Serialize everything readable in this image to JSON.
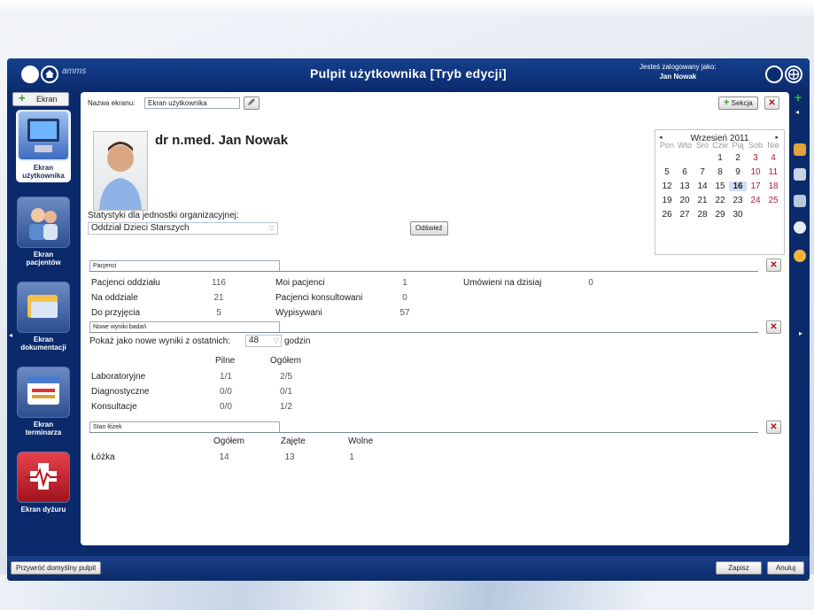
{
  "app": {
    "title": "Pulpit użytkownika [Tryb edycji]",
    "brand": "amms"
  },
  "user": {
    "logged_label": "Jesteś zalogowany jako:",
    "name": "Jan Nowak"
  },
  "leftbar": {
    "add_screen_label": "Ekran",
    "items": [
      {
        "label": "Ekran\nużytkownika",
        "icon": "desktop-icon"
      },
      {
        "label": "Ekran\npacjentów",
        "icon": "patients-icon"
      },
      {
        "label": "Ekran\ndokumentacji",
        "icon": "documents-icon"
      },
      {
        "label": "Ekran\nterminarza",
        "icon": "calendar-icon"
      },
      {
        "label": "Ekran dyżuru",
        "icon": "heartbeat-icon"
      }
    ]
  },
  "screen": {
    "name_label": "Nazwa ekranu:",
    "name_value": "Ekran użytkownika",
    "add_section_label": "Sekcja"
  },
  "doctor": {
    "name": "dr n.med. Jan Nowak"
  },
  "org": {
    "label": "Statystyki dla jednostki organizacyjnej:",
    "selected": "Oddział Dzieci Starszych",
    "refresh_label": "Odśwież"
  },
  "calendar": {
    "month": "Wrzesień 2011",
    "weekdays": [
      "Pon",
      "Wto",
      "Śro",
      "Czw",
      "Pią",
      "Sob",
      "Nie"
    ],
    "weeks": [
      [
        "",
        "",
        "",
        "1",
        "2",
        "3",
        "4"
      ],
      [
        "5",
        "6",
        "7",
        "8",
        "9",
        "10",
        "11"
      ],
      [
        "12",
        "13",
        "14",
        "15",
        "16",
        "17",
        "18"
      ],
      [
        "19",
        "20",
        "21",
        "22",
        "23",
        "24",
        "25"
      ],
      [
        "26",
        "27",
        "28",
        "29",
        "30",
        "",
        ""
      ]
    ],
    "today": "16",
    "weekend_color": "#b0203a"
  },
  "patients": {
    "section_title": "Pacjenci",
    "rows": [
      {
        "l1": "Pacjenci oddziału",
        "v1": "116",
        "l2": "Moi pacjenci",
        "v2": "1",
        "l3": "Umówieni na dzisiaj",
        "v3": "0"
      },
      {
        "l1": "Na oddziale",
        "v1": "21",
        "l2": "Pacjenci konsultowani",
        "v2": "0"
      },
      {
        "l1": "Do przyjęcia",
        "v1": "5",
        "l2": "Wypisywani",
        "v2": "57"
      }
    ]
  },
  "results": {
    "section_title": "Nowe wyniki badań",
    "show_label": "Pokaż jako nowe wyniki z ostatnich:",
    "hours_value": "48",
    "hours_unit": "godzin",
    "headers": [
      "Pilne",
      "Ogółem"
    ],
    "rows": [
      {
        "label": "Laboratoryjne",
        "urgent": "1/1",
        "total": "2/5"
      },
      {
        "label": "Diagnostyczne",
        "urgent": "0/0",
        "total": "0/1"
      },
      {
        "label": "Konsultacje",
        "urgent": "0/0",
        "total": "1/2"
      }
    ]
  },
  "beds": {
    "section_title": "Stan łóżek",
    "headers": [
      "Ogółem",
      "Zajęte",
      "Wolne"
    ],
    "label": "Łóżka",
    "values": [
      "14",
      "13",
      "1"
    ]
  },
  "bottom": {
    "restore_label": "Przywróć domyślny pulpit",
    "save_label": "Zapisz",
    "cancel_label": "Anuluj"
  }
}
